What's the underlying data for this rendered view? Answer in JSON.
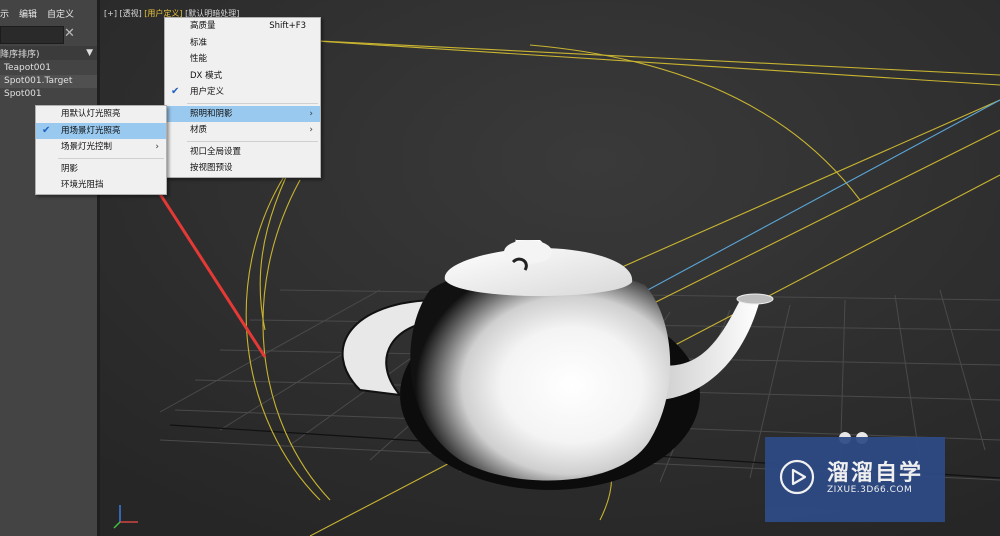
{
  "menubar": {
    "items": [
      "示",
      "编辑",
      "自定义"
    ]
  },
  "scene_explorer": {
    "sort_label": "降序排序)",
    "objects": [
      "Teapot001",
      "Spot001.Target",
      "Spot001"
    ]
  },
  "viewport": {
    "labels": [
      "[+]",
      "[透视]",
      "[用户定义]",
      "[默认明暗处理]"
    ]
  },
  "main_menu": {
    "items": [
      {
        "label": "高质量",
        "shortcut": "Shift+F3"
      },
      {
        "label": "标准"
      },
      {
        "label": "性能"
      },
      {
        "label": "DX 模式"
      },
      {
        "label": "用户定义",
        "checked": true
      },
      {
        "label": "照明和阴影",
        "submenu": true,
        "highlighted": true
      },
      {
        "label": "材质",
        "submenu": true
      },
      {
        "label": "视口全局设置"
      },
      {
        "label": "按视图预设"
      }
    ]
  },
  "lighting_submenu": {
    "items": [
      {
        "label": "用默认灯光照亮"
      },
      {
        "label": "用场景灯光照亮",
        "checked": true,
        "highlighted": true
      },
      {
        "label": "场景灯光控制",
        "submenu": true
      },
      {
        "label": "阴影"
      },
      {
        "label": "环境光阻挡"
      }
    ]
  },
  "watermark": {
    "title": "溜溜自学",
    "url": "ZIXUE.3D66.COM"
  },
  "colors": {
    "menu_highlight": "#99c9ef",
    "active_label": "#e7c63c",
    "arrow": "#e53935",
    "light_cone": "#c8b431",
    "light_ray": "#5aa6d8"
  },
  "icons": [
    "close-icon",
    "dropdown-arrow-icon",
    "checkmark-icon",
    "submenu-arrow-icon",
    "play-logo-icon",
    "axis-gizmo-icon"
  ]
}
